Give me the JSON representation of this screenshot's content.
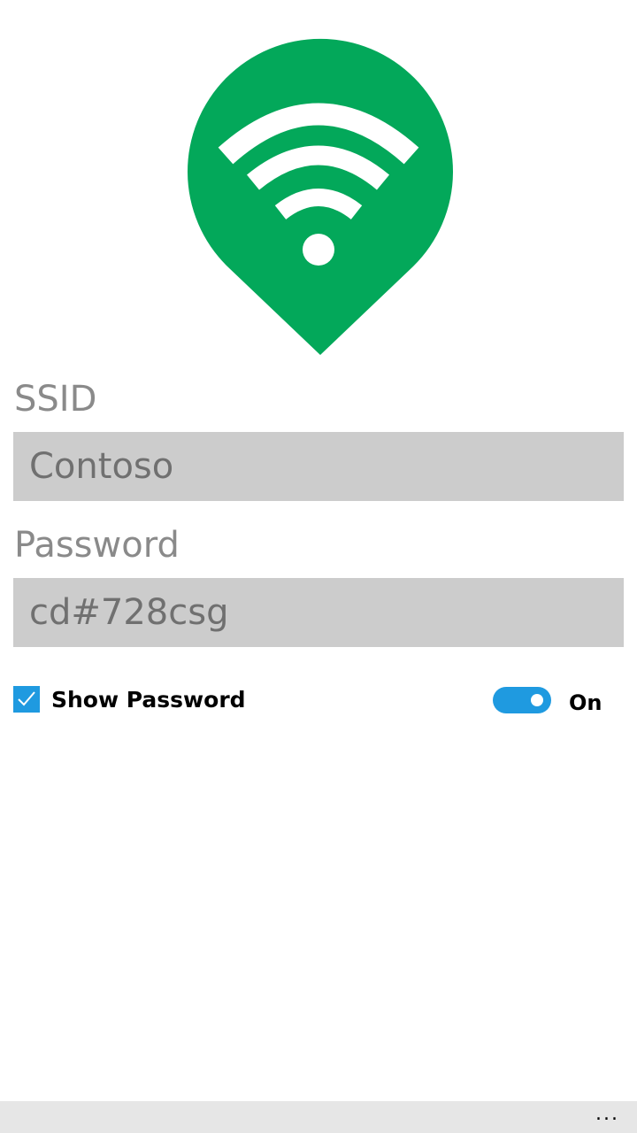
{
  "colors": {
    "brand_green": "#03A85A",
    "accent_blue": "#1F9AE0",
    "field_background": "#CCCCCC",
    "label_gray": "#8A8A8A",
    "app_bar_background": "#E6E6E6"
  },
  "logo": {
    "icon": "wifi-location-pin-icon"
  },
  "ssid": {
    "label": "SSID",
    "value": "Contoso"
  },
  "password": {
    "label": "Password",
    "value": "cd#728csg"
  },
  "show_password": {
    "label": "Show Password",
    "checked": true,
    "icon": "checkmark-icon"
  },
  "toggle": {
    "state_label": "On",
    "on": true
  },
  "app_bar": {
    "more_label": "...",
    "icon": "more-options-icon"
  }
}
